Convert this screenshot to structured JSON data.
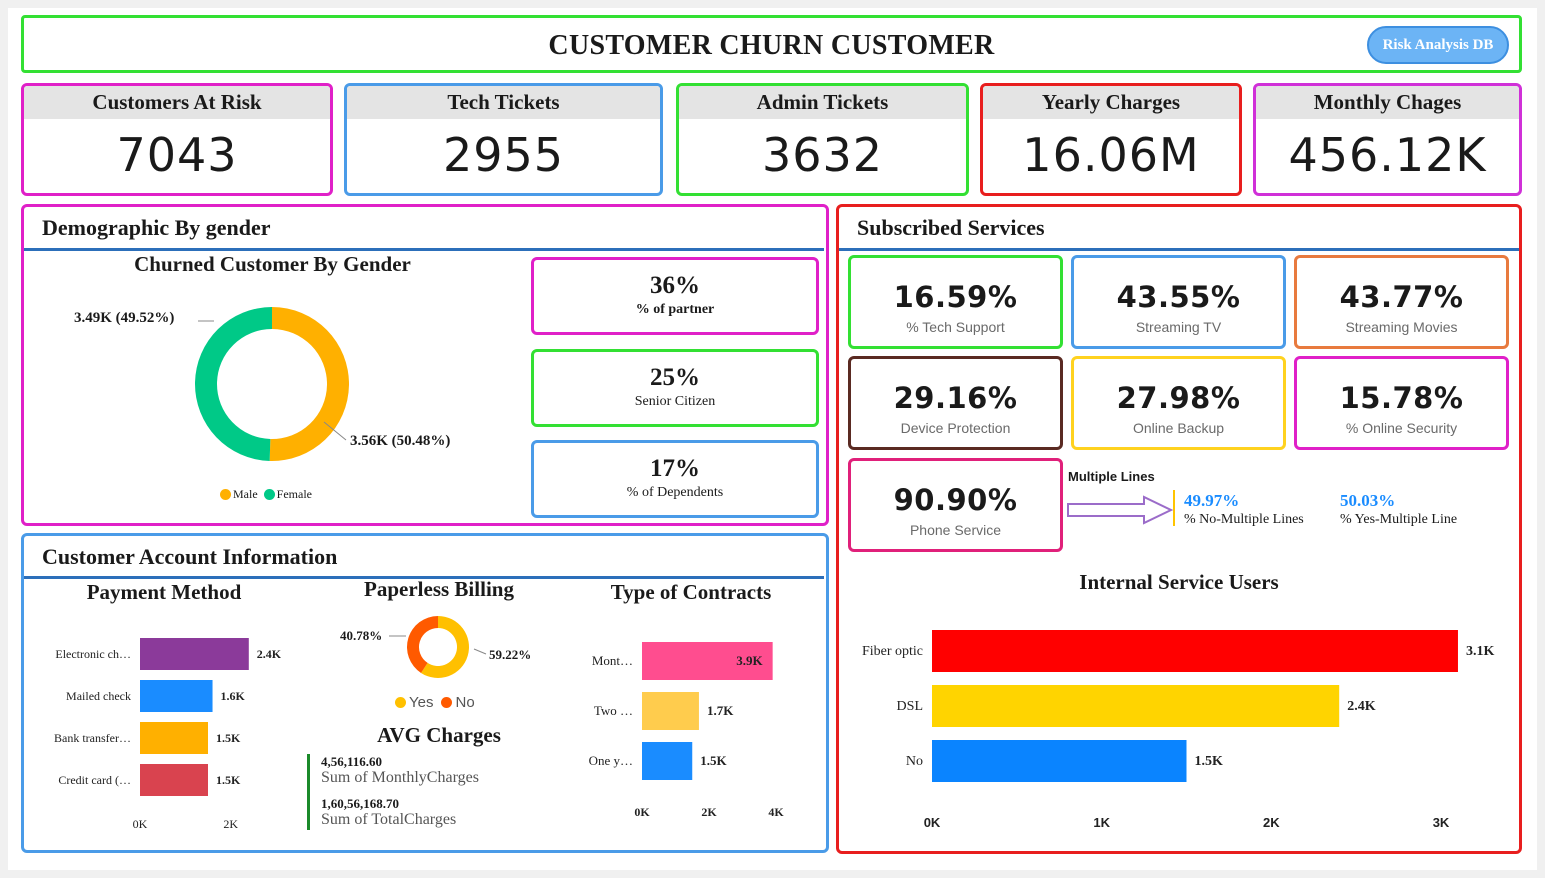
{
  "header": {
    "title": "CUSTOMER CHURN CUSTOMER",
    "button_label": "Risk Analysis DB"
  },
  "kpis": [
    {
      "title": "Customers At Risk",
      "value": "7043",
      "color": "#e020c8"
    },
    {
      "title": "Tech Tickets",
      "value": "2955",
      "color": "#4a9be8"
    },
    {
      "title": "Admin Tickets",
      "value": "3632",
      "color": "#33e033"
    },
    {
      "title": "Yearly Charges",
      "value": "16.06M",
      "color": "#e81e1e"
    },
    {
      "title": "Monthly Chages",
      "value": "456.12K",
      "color": "#d030d8"
    }
  ],
  "demographic": {
    "panel_title": "Demographic By gender",
    "chart_title": "Churned Customer By Gender",
    "label_female": "3.49K (49.52%)",
    "label_male": "3.56K (50.48%)",
    "legend": [
      "Male",
      "Female"
    ],
    "stats": [
      {
        "value": "36%",
        "label": "% of partner"
      },
      {
        "value": "25%",
        "label": "Senior Citizen"
      },
      {
        "value": "17%",
        "label": "% of Dependents"
      }
    ]
  },
  "services": {
    "panel_title": "Subscribed Services",
    "boxes": [
      {
        "value": "16.59%",
        "label": "% Tech Support"
      },
      {
        "value": "43.55%",
        "label": "Streaming TV"
      },
      {
        "value": "43.77%",
        "label": "Streaming Movies"
      },
      {
        "value": "29.16%",
        "label": "Device Protection"
      },
      {
        "value": "27.98%",
        "label": "Online Backup"
      },
      {
        "value": "15.78%",
        "label": "% Online Security"
      },
      {
        "value": "90.90%",
        "label": "Phone Service"
      }
    ],
    "multiple_lines_label": "Multiple Lines",
    "no_multi_value": "49.97%",
    "no_multi_label": "% No-Multiple Lines",
    "yes_multi_value": "50.03%",
    "yes_multi_label": "% Yes-Multiple Line",
    "internet_title": "Internal Service Users"
  },
  "account": {
    "panel_title": "Customer Account Information",
    "payment_title": "Payment Method",
    "paperless_title": "Paperless Billing",
    "paperless_yes_label": "59.22%",
    "paperless_no_label": "40.78%",
    "paperless_legend": [
      "Yes",
      "No"
    ],
    "contracts_title": "Type of Contracts",
    "avg_title": "AVG Charges",
    "avg_monthly_value": "4,56,116.60",
    "avg_monthly_label": "Sum of MonthlyCharges",
    "avg_total_value": "1,60,56,168.70",
    "avg_total_label": "Sum of TotalCharges"
  },
  "chart_data": [
    {
      "type": "pie",
      "title": "Churned Customer By Gender",
      "categories": [
        "Male",
        "Female"
      ],
      "values": [
        3.56,
        3.49
      ],
      "percent": [
        50.48,
        49.52
      ],
      "colors": [
        "#ffb000",
        "#00c987"
      ],
      "legend": "bottom"
    },
    {
      "type": "bar",
      "title": "Payment Method",
      "categories": [
        "Electronic ch…",
        "Mailed check",
        "Bank transfer…",
        "Credit card (…"
      ],
      "values": [
        2.4,
        1.6,
        1.5,
        1.5
      ],
      "data_labels": [
        "2.4K",
        "1.6K",
        "1.5K",
        "1.5K"
      ],
      "x_ticks": [
        "0K",
        "2K"
      ],
      "xlim": [
        0,
        3
      ],
      "colors": [
        "#8b3a9a",
        "#1a8cff",
        "#ffb000",
        "#d9434f"
      ]
    },
    {
      "type": "pie",
      "title": "Paperless Billing",
      "categories": [
        "Yes",
        "No"
      ],
      "percent": [
        59.22,
        40.78
      ],
      "colors": [
        "#ffc000",
        "#ff5a00"
      ],
      "legend": "bottom"
    },
    {
      "type": "bar",
      "title": "Type of Contracts",
      "categories": [
        "Mont…",
        "Two …",
        "One y…"
      ],
      "values": [
        3.9,
        1.7,
        1.5
      ],
      "data_labels": [
        "3.9K",
        "1.7K",
        "1.5K"
      ],
      "x_ticks": [
        "0K",
        "2K",
        "4K"
      ],
      "xlim": [
        0,
        4
      ],
      "colors": [
        "#ff4d8f",
        "#ffcc4d",
        "#1a8cff"
      ]
    },
    {
      "type": "bar",
      "title": "Internal Service Users",
      "categories": [
        "Fiber optic",
        "DSL",
        "No"
      ],
      "values": [
        3.1,
        2.4,
        1.5
      ],
      "data_labels": [
        "3.1K",
        "2.4K",
        "1.5K"
      ],
      "x_ticks": [
        "0K",
        "1K",
        "2K",
        "3K"
      ],
      "xlim": [
        0,
        3.0
      ],
      "colors": [
        "#ff0000",
        "#ffd400",
        "#0a84ff"
      ]
    }
  ]
}
